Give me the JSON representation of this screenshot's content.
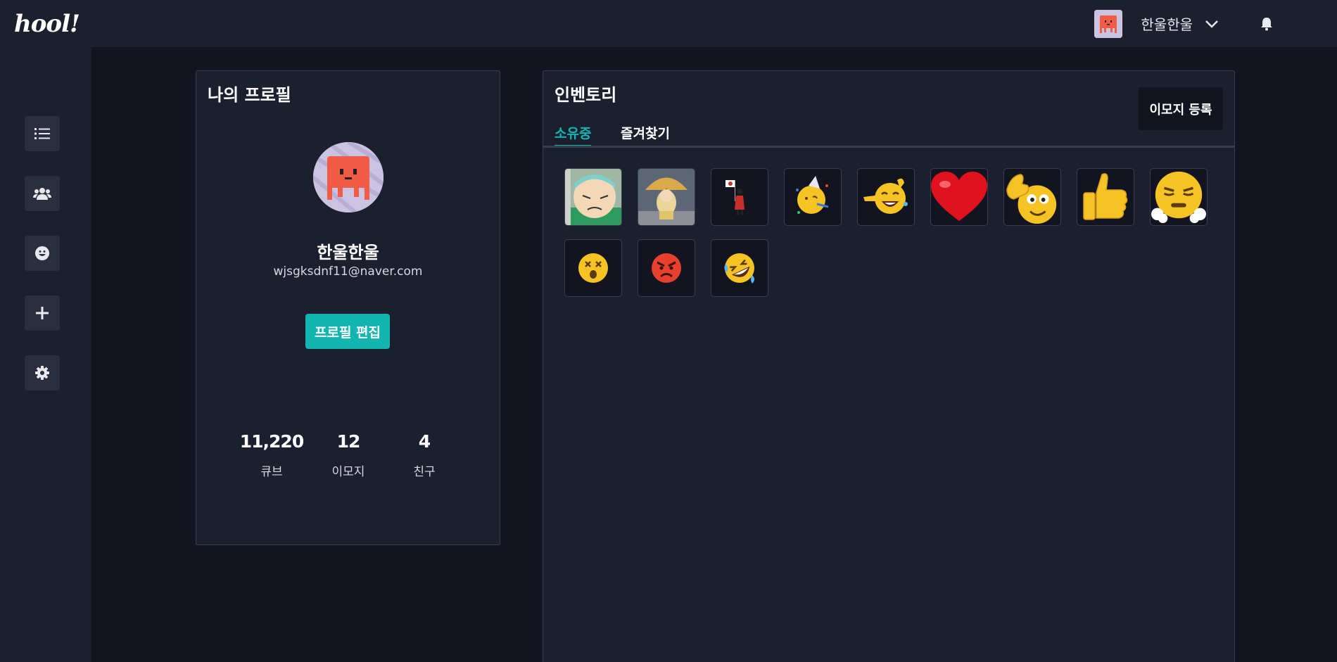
{
  "header": {
    "logo": "hool!",
    "username": "한울한울"
  },
  "sidebar": {
    "items": [
      {
        "icon": "list-icon"
      },
      {
        "icon": "users-icon"
      },
      {
        "icon": "smile-icon"
      },
      {
        "icon": "plus-icon"
      },
      {
        "icon": "gear-icon"
      }
    ]
  },
  "profile": {
    "title": "나의 프로필",
    "name": "한울한울",
    "email": "wjsgksdnf11@naver.com",
    "edit_label": "프로필 편집",
    "stats": [
      {
        "value": "11,220",
        "label": "큐브"
      },
      {
        "value": "12",
        "label": "이모지"
      },
      {
        "value": "4",
        "label": "친구"
      }
    ]
  },
  "inventory": {
    "title": "인벤토리",
    "register_label": "이모지 등록",
    "tabs": [
      {
        "label": "소유중",
        "active": true
      },
      {
        "label": "즐겨찾기",
        "active": false
      }
    ],
    "emojis": [
      {
        "icon": "cartoon-grandpa-emoji"
      },
      {
        "icon": "cartoon-umbrella-emoji"
      },
      {
        "icon": "flag-figure-emoji"
      },
      {
        "icon": "party-face-emoji"
      },
      {
        "icon": "laughing-pointing-emoji"
      },
      {
        "icon": "red-heart-emoji"
      },
      {
        "icon": "thumbs-up-face-emoji"
      },
      {
        "icon": "thumbs-up-emoji"
      },
      {
        "icon": "steaming-face-emoji"
      },
      {
        "icon": "dizzy-face-emoji"
      },
      {
        "icon": "angry-face-emoji"
      },
      {
        "icon": "rolling-laughing-emoji"
      }
    ]
  }
}
